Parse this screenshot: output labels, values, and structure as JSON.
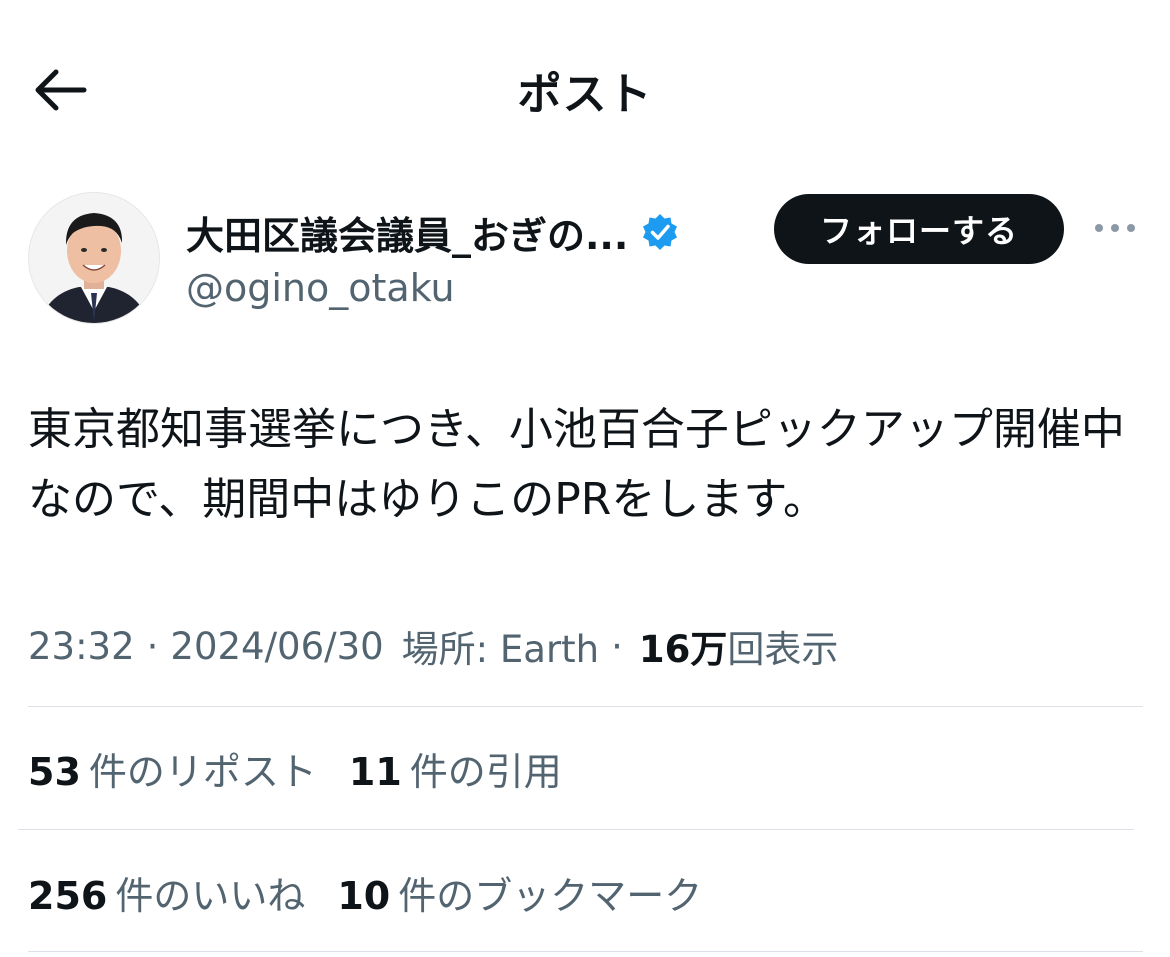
{
  "header": {
    "title": "ポスト",
    "back_icon": "arrow-left-icon"
  },
  "author": {
    "display_name": "大田区議会議員_おぎの...",
    "handle": "@ogino_otaku",
    "verified_icon": "verified-badge-icon",
    "verified_color": "#1d9bf0",
    "follow_label": "フォローする",
    "more_icon": "more-horizontal-icon"
  },
  "post": {
    "text": "東京都知事選挙につき、小池百合子ピックアップ開催中なので、期間中はゆりこのPRをします。"
  },
  "meta": {
    "time": "23:32",
    "separator": "·",
    "date": "2024/06/30",
    "location": "場所: Earth",
    "views_count": "16万",
    "views_label": "回表示"
  },
  "stats": {
    "reposts_count": "53",
    "reposts_label": "件のリポスト",
    "quotes_count": "11",
    "quotes_label": "件の引用",
    "likes_count": "256",
    "likes_label": "件のいいね",
    "bookmarks_count": "10",
    "bookmarks_label": "件のブックマーク"
  },
  "colors": {
    "text_primary": "#0f1419",
    "text_secondary": "#536471",
    "divider": "#dbe1e6",
    "follow_bg": "#0f1419"
  }
}
